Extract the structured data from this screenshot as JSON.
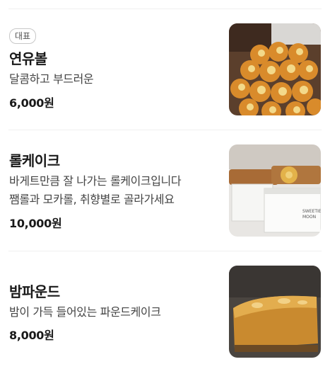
{
  "menu": {
    "items": [
      {
        "badge": "대표",
        "name": "연유볼",
        "description": [
          "달콤하고 부드러운"
        ],
        "price": "6,000원",
        "image_icon": "buns-photo"
      },
      {
        "badge": "",
        "name": "롤케이크",
        "description": [
          "바게트만큼 잘 나가는 롤케이크입니다",
          "쨈롤과 모카롤, 취향별로 골라가세요"
        ],
        "price": "10,000원",
        "image_icon": "roll-cake-photo"
      },
      {
        "badge": "",
        "name": "밤파운드",
        "description": [
          "밤이 가득 들어있는 파운드케이크"
        ],
        "price": "8,000원",
        "image_icon": "chestnut-pound-cake-photo"
      }
    ]
  }
}
